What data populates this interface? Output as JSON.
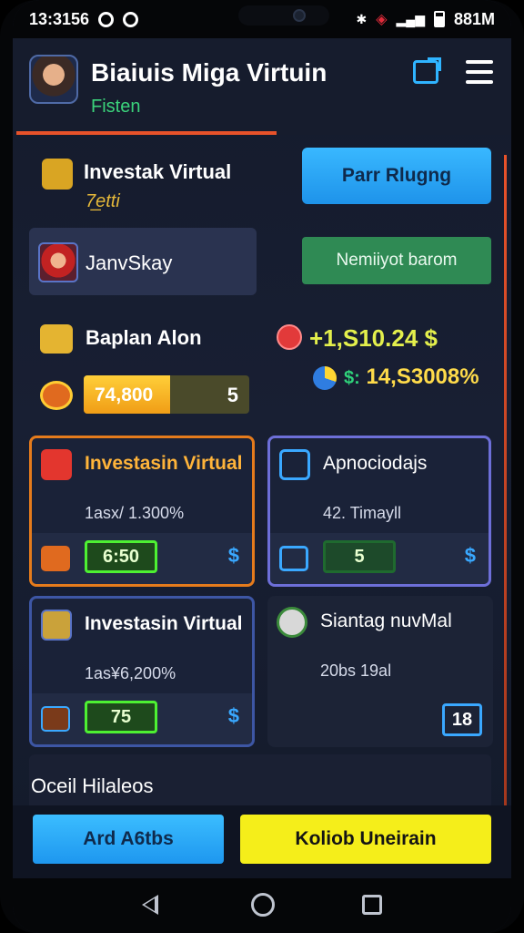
{
  "status_bar": {
    "time": "13:3156",
    "battery": "881M"
  },
  "header": {
    "title": "Biaiuis Miga Virtuin",
    "subtitle": "Fisten"
  },
  "investment": {
    "title": "Investak Virtual",
    "subtitle": "7̲etti"
  },
  "primary_button": "Parr Rlugng",
  "user": {
    "name": "JanvSkay"
  },
  "secondary_button": "Nemiiyot barom",
  "wallet": {
    "title": "Baplan Alon",
    "progress_value": "74,800",
    "progress_fraction": 0.52,
    "progress_count": "5"
  },
  "balance": {
    "amount": "+1,S10.24 $",
    "percent_label": "$:",
    "percent_value": "14,S3008%"
  },
  "cards": [
    {
      "title": "Investasin Virtual",
      "stat": "1asx/ 1.300%",
      "badge": "6:50",
      "currency": "$"
    },
    {
      "title": "Apnociodajs",
      "stat": "42. Timayll",
      "badge": "5",
      "currency": "$"
    },
    {
      "title": "Investasin Virtual",
      "stat": "1as¥6,200%",
      "badge": "75",
      "currency": "$"
    },
    {
      "title": "Siantag nuvMal",
      "stat": "20bs 19al",
      "badge": "18"
    }
  ],
  "others": {
    "title": "Oceil Hilaleos"
  },
  "bottom": {
    "add_label": "Ard A6tbs",
    "yellow_label": "Koliob Uneirain"
  },
  "colors": {
    "accent_blue": "#39b8ff",
    "accent_green": "#2f8a54",
    "accent_yellow": "#f5ee1a",
    "accent_orange": "#e8522a"
  }
}
